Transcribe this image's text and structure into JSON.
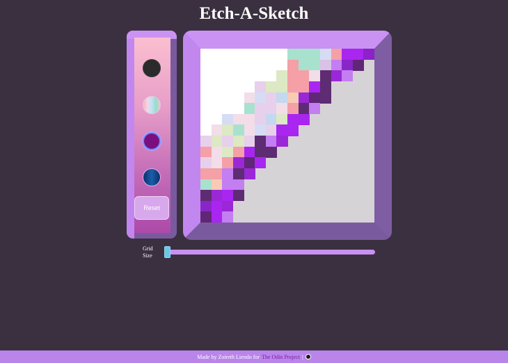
{
  "title": "Etch-A-Sketch",
  "palette": {
    "swatches": [
      {
        "name": "black",
        "selected": false
      },
      {
        "name": "pastel-rainbow",
        "selected": false
      },
      {
        "name": "purple",
        "selected": true
      },
      {
        "name": "blue-gradient",
        "selected": false
      }
    ],
    "reset_label": "Reset"
  },
  "slider": {
    "label_line1": "Grid",
    "label_line2": "Size",
    "value_fraction": 0.0
  },
  "footer": {
    "prefix": "Made by Zoireth Liendo for",
    "link_text": "The Odin Project",
    "icon": "github-icon"
  },
  "grid": {
    "cols": 16,
    "rows": 16,
    "background": "#d6d3d6",
    "cells": [
      [
        0,
        0,
        "#ffffff"
      ],
      [
        1,
        0,
        "#ffffff"
      ],
      [
        2,
        0,
        "#ffffff"
      ],
      [
        3,
        0,
        "#ffffff"
      ],
      [
        4,
        0,
        "#ffffff"
      ],
      [
        5,
        0,
        "#ffffff"
      ],
      [
        6,
        0,
        "#ffffff"
      ],
      [
        7,
        0,
        "#ffffff"
      ],
      [
        8,
        0,
        "#a9e1cf"
      ],
      [
        9,
        0,
        "#a9e1cf"
      ],
      [
        10,
        0,
        "#a9e1cf"
      ],
      [
        11,
        0,
        "#d6dcf4"
      ],
      [
        12,
        0,
        "#f4a0a6"
      ],
      [
        13,
        0,
        "#a926f0"
      ],
      [
        14,
        0,
        "#a926f0"
      ],
      [
        15,
        0,
        "#8c22c8"
      ],
      [
        0,
        1,
        "#ffffff"
      ],
      [
        1,
        1,
        "#ffffff"
      ],
      [
        2,
        1,
        "#ffffff"
      ],
      [
        3,
        1,
        "#ffffff"
      ],
      [
        4,
        1,
        "#ffffff"
      ],
      [
        5,
        1,
        "#ffffff"
      ],
      [
        6,
        1,
        "#ffffff"
      ],
      [
        7,
        1,
        "#ffffff"
      ],
      [
        8,
        1,
        "#f4a0a6"
      ],
      [
        9,
        1,
        "#a9e1cf"
      ],
      [
        10,
        1,
        "#a9e1cf"
      ],
      [
        11,
        1,
        "#d9c2e6"
      ],
      [
        12,
        1,
        "#c37ef2"
      ],
      [
        13,
        1,
        "#8a26c8"
      ],
      [
        14,
        1,
        "#5f2776"
      ],
      [
        0,
        2,
        "#ffffff"
      ],
      [
        1,
        2,
        "#ffffff"
      ],
      [
        2,
        2,
        "#ffffff"
      ],
      [
        3,
        2,
        "#ffffff"
      ],
      [
        4,
        2,
        "#ffffff"
      ],
      [
        5,
        2,
        "#ffffff"
      ],
      [
        6,
        2,
        "#ffffff"
      ],
      [
        7,
        2,
        "#dde8c4"
      ],
      [
        8,
        2,
        "#f4a0a6"
      ],
      [
        9,
        2,
        "#f4a0a6"
      ],
      [
        10,
        2,
        "#f2dde9"
      ],
      [
        11,
        2,
        "#5d2c72"
      ],
      [
        12,
        2,
        "#9b28d6"
      ],
      [
        13,
        2,
        "#c37ef2"
      ],
      [
        0,
        3,
        "#ffffff"
      ],
      [
        1,
        3,
        "#ffffff"
      ],
      [
        2,
        3,
        "#ffffff"
      ],
      [
        3,
        3,
        "#ffffff"
      ],
      [
        4,
        3,
        "#ffffff"
      ],
      [
        5,
        3,
        "#e7d0eb"
      ],
      [
        6,
        3,
        "#dde8c4"
      ],
      [
        7,
        3,
        "#dde8c4"
      ],
      [
        8,
        3,
        "#f4a0a6"
      ],
      [
        9,
        3,
        "#f4a0a6"
      ],
      [
        10,
        3,
        "#a926f0"
      ],
      [
        11,
        3,
        "#5d2c72"
      ],
      [
        0,
        4,
        "#ffffff"
      ],
      [
        1,
        4,
        "#ffffff"
      ],
      [
        2,
        4,
        "#ffffff"
      ],
      [
        3,
        4,
        "#ffffff"
      ],
      [
        4,
        4,
        "#f2dde9"
      ],
      [
        5,
        4,
        "#d6dcf4"
      ],
      [
        6,
        4,
        "#e7d0eb"
      ],
      [
        7,
        4,
        "#c4d8f0"
      ],
      [
        8,
        4,
        "#f7cbb5"
      ],
      [
        9,
        4,
        "#9b28d6"
      ],
      [
        10,
        4,
        "#5f2776"
      ],
      [
        11,
        4,
        "#5d2c72"
      ],
      [
        0,
        5,
        "#ffffff"
      ],
      [
        1,
        5,
        "#ffffff"
      ],
      [
        2,
        5,
        "#ffffff"
      ],
      [
        3,
        5,
        "#ffffff"
      ],
      [
        4,
        5,
        "#a9e1cf"
      ],
      [
        5,
        5,
        "#e7d0eb"
      ],
      [
        6,
        5,
        "#e7d0eb"
      ],
      [
        7,
        5,
        "#f2dde9"
      ],
      [
        8,
        5,
        "#f4a0a6"
      ],
      [
        9,
        5,
        "#5d2c72"
      ],
      [
        10,
        5,
        "#c37ef2"
      ],
      [
        0,
        6,
        "#ffffff"
      ],
      [
        1,
        6,
        "#ffffff"
      ],
      [
        2,
        6,
        "#d6dcf4"
      ],
      [
        3,
        6,
        "#f2dde9"
      ],
      [
        4,
        6,
        "#f2dde9"
      ],
      [
        5,
        6,
        "#e7d0eb"
      ],
      [
        6,
        6,
        "#c4d8f0"
      ],
      [
        7,
        6,
        "#dde8c4"
      ],
      [
        8,
        6,
        "#a926f0"
      ],
      [
        9,
        6,
        "#a926f0"
      ],
      [
        0,
        7,
        "#ffffff"
      ],
      [
        1,
        7,
        "#f2dde9"
      ],
      [
        2,
        7,
        "#dde8c4"
      ],
      [
        3,
        7,
        "#a9e1cf"
      ],
      [
        4,
        7,
        "#f2dde9"
      ],
      [
        5,
        7,
        "#d6dcf4"
      ],
      [
        6,
        7,
        "#e7d0eb"
      ],
      [
        7,
        7,
        "#a926f0"
      ],
      [
        8,
        7,
        "#a926f0"
      ],
      [
        0,
        8,
        "#e7d0eb"
      ],
      [
        1,
        8,
        "#dde8c4"
      ],
      [
        2,
        8,
        "#e7d0eb"
      ],
      [
        3,
        8,
        "#dde8c4"
      ],
      [
        4,
        8,
        "#e7d0eb"
      ],
      [
        5,
        8,
        "#5d2c72"
      ],
      [
        6,
        8,
        "#c37ef2"
      ],
      [
        7,
        8,
        "#9b28d6"
      ],
      [
        0,
        9,
        "#f4a0a6"
      ],
      [
        1,
        9,
        "#f2dde9"
      ],
      [
        2,
        9,
        "#dde8c4"
      ],
      [
        3,
        9,
        "#f4a0a6"
      ],
      [
        4,
        9,
        "#a926f0"
      ],
      [
        5,
        9,
        "#5d2c72"
      ],
      [
        6,
        9,
        "#5d2c72"
      ],
      [
        0,
        10,
        "#e7d0eb"
      ],
      [
        1,
        10,
        "#f2dde9"
      ],
      [
        2,
        10,
        "#f4a0a6"
      ],
      [
        3,
        10,
        "#9b28d6"
      ],
      [
        4,
        10,
        "#5f2776"
      ],
      [
        5,
        10,
        "#a926f0"
      ],
      [
        0,
        11,
        "#f4a0a6"
      ],
      [
        1,
        11,
        "#f4a0a6"
      ],
      [
        2,
        11,
        "#c37ef2"
      ],
      [
        3,
        11,
        "#5d2c72"
      ],
      [
        4,
        11,
        "#9b28d6"
      ],
      [
        0,
        12,
        "#a9e1cf"
      ],
      [
        1,
        12,
        "#f7cbb5"
      ],
      [
        2,
        12,
        "#c37ef2"
      ],
      [
        3,
        12,
        "#c37ef2"
      ],
      [
        0,
        13,
        "#5d2c72"
      ],
      [
        1,
        13,
        "#9b28d6"
      ],
      [
        2,
        13,
        "#a926f0"
      ],
      [
        3,
        13,
        "#5d2c72"
      ],
      [
        0,
        14,
        "#8a26c8"
      ],
      [
        1,
        14,
        "#a926f0"
      ],
      [
        2,
        14,
        "#9b28d6"
      ],
      [
        0,
        15,
        "#5f2776"
      ],
      [
        1,
        15,
        "#a926f0"
      ],
      [
        2,
        15,
        "#c37ef2"
      ],
      [
        1,
        16,
        "#9b28d6"
      ]
    ]
  },
  "colors": {
    "background": "#3b3040",
    "frame": "#7a5a9e",
    "frame_light": "#c992f3",
    "accent": "#b985ea",
    "link": "#7a1fa3",
    "slider_thumb": "#6bc6e8"
  }
}
